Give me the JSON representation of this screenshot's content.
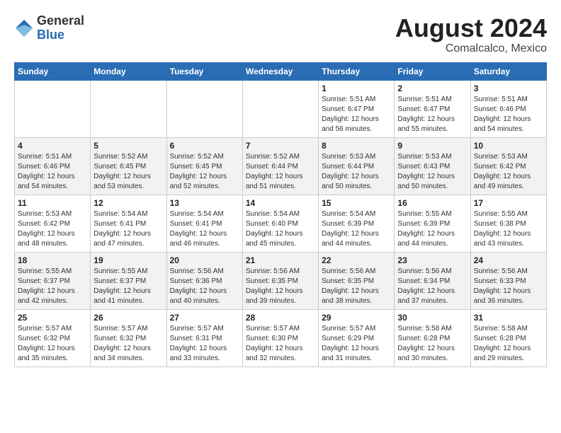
{
  "header": {
    "logo_general": "General",
    "logo_blue": "Blue",
    "month_year": "August 2024",
    "location": "Comalcalco, Mexico"
  },
  "days_of_week": [
    "Sunday",
    "Monday",
    "Tuesday",
    "Wednesday",
    "Thursday",
    "Friday",
    "Saturday"
  ],
  "weeks": [
    [
      {
        "day": "",
        "info": ""
      },
      {
        "day": "",
        "info": ""
      },
      {
        "day": "",
        "info": ""
      },
      {
        "day": "",
        "info": ""
      },
      {
        "day": "1",
        "info": "Sunrise: 5:51 AM\nSunset: 6:47 PM\nDaylight: 12 hours\nand 56 minutes."
      },
      {
        "day": "2",
        "info": "Sunrise: 5:51 AM\nSunset: 6:47 PM\nDaylight: 12 hours\nand 55 minutes."
      },
      {
        "day": "3",
        "info": "Sunrise: 5:51 AM\nSunset: 6:46 PM\nDaylight: 12 hours\nand 54 minutes."
      }
    ],
    [
      {
        "day": "4",
        "info": "Sunrise: 5:51 AM\nSunset: 6:46 PM\nDaylight: 12 hours\nand 54 minutes."
      },
      {
        "day": "5",
        "info": "Sunrise: 5:52 AM\nSunset: 6:45 PM\nDaylight: 12 hours\nand 53 minutes."
      },
      {
        "day": "6",
        "info": "Sunrise: 5:52 AM\nSunset: 6:45 PM\nDaylight: 12 hours\nand 52 minutes."
      },
      {
        "day": "7",
        "info": "Sunrise: 5:52 AM\nSunset: 6:44 PM\nDaylight: 12 hours\nand 51 minutes."
      },
      {
        "day": "8",
        "info": "Sunrise: 5:53 AM\nSunset: 6:44 PM\nDaylight: 12 hours\nand 50 minutes."
      },
      {
        "day": "9",
        "info": "Sunrise: 5:53 AM\nSunset: 6:43 PM\nDaylight: 12 hours\nand 50 minutes."
      },
      {
        "day": "10",
        "info": "Sunrise: 5:53 AM\nSunset: 6:42 PM\nDaylight: 12 hours\nand 49 minutes."
      }
    ],
    [
      {
        "day": "11",
        "info": "Sunrise: 5:53 AM\nSunset: 6:42 PM\nDaylight: 12 hours\nand 48 minutes."
      },
      {
        "day": "12",
        "info": "Sunrise: 5:54 AM\nSunset: 6:41 PM\nDaylight: 12 hours\nand 47 minutes."
      },
      {
        "day": "13",
        "info": "Sunrise: 5:54 AM\nSunset: 6:41 PM\nDaylight: 12 hours\nand 46 minutes."
      },
      {
        "day": "14",
        "info": "Sunrise: 5:54 AM\nSunset: 6:40 PM\nDaylight: 12 hours\nand 45 minutes."
      },
      {
        "day": "15",
        "info": "Sunrise: 5:54 AM\nSunset: 6:39 PM\nDaylight: 12 hours\nand 44 minutes."
      },
      {
        "day": "16",
        "info": "Sunrise: 5:55 AM\nSunset: 6:39 PM\nDaylight: 12 hours\nand 44 minutes."
      },
      {
        "day": "17",
        "info": "Sunrise: 5:55 AM\nSunset: 6:38 PM\nDaylight: 12 hours\nand 43 minutes."
      }
    ],
    [
      {
        "day": "18",
        "info": "Sunrise: 5:55 AM\nSunset: 6:37 PM\nDaylight: 12 hours\nand 42 minutes."
      },
      {
        "day": "19",
        "info": "Sunrise: 5:55 AM\nSunset: 6:37 PM\nDaylight: 12 hours\nand 41 minutes."
      },
      {
        "day": "20",
        "info": "Sunrise: 5:56 AM\nSunset: 6:36 PM\nDaylight: 12 hours\nand 40 minutes."
      },
      {
        "day": "21",
        "info": "Sunrise: 5:56 AM\nSunset: 6:35 PM\nDaylight: 12 hours\nand 39 minutes."
      },
      {
        "day": "22",
        "info": "Sunrise: 5:56 AM\nSunset: 6:35 PM\nDaylight: 12 hours\nand 38 minutes."
      },
      {
        "day": "23",
        "info": "Sunrise: 5:56 AM\nSunset: 6:34 PM\nDaylight: 12 hours\nand 37 minutes."
      },
      {
        "day": "24",
        "info": "Sunrise: 5:56 AM\nSunset: 6:33 PM\nDaylight: 12 hours\nand 36 minutes."
      }
    ],
    [
      {
        "day": "25",
        "info": "Sunrise: 5:57 AM\nSunset: 6:32 PM\nDaylight: 12 hours\nand 35 minutes."
      },
      {
        "day": "26",
        "info": "Sunrise: 5:57 AM\nSunset: 6:32 PM\nDaylight: 12 hours\nand 34 minutes."
      },
      {
        "day": "27",
        "info": "Sunrise: 5:57 AM\nSunset: 6:31 PM\nDaylight: 12 hours\nand 33 minutes."
      },
      {
        "day": "28",
        "info": "Sunrise: 5:57 AM\nSunset: 6:30 PM\nDaylight: 12 hours\nand 32 minutes."
      },
      {
        "day": "29",
        "info": "Sunrise: 5:57 AM\nSunset: 6:29 PM\nDaylight: 12 hours\nand 31 minutes."
      },
      {
        "day": "30",
        "info": "Sunrise: 5:58 AM\nSunset: 6:28 PM\nDaylight: 12 hours\nand 30 minutes."
      },
      {
        "day": "31",
        "info": "Sunrise: 5:58 AM\nSunset: 6:28 PM\nDaylight: 12 hours\nand 29 minutes."
      }
    ]
  ]
}
